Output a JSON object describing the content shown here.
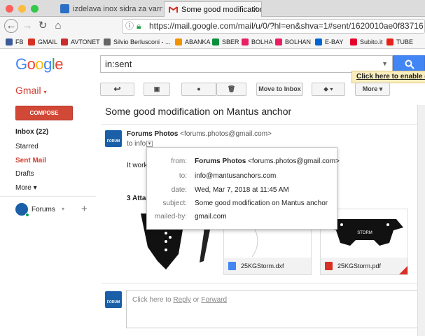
{
  "browser": {
    "tabs": [
      {
        "label": "izdelava inox sidra za varno sid"
      },
      {
        "label": "Some good modification on Ma"
      }
    ],
    "url": "https://mail.google.com/mail/u/0/?hl=en&shva=1#sent/1620010ae0f83716",
    "bookmarks": [
      {
        "label": "FB",
        "color": "#3b5998"
      },
      {
        "label": "GMAIL",
        "color": "#d93025"
      },
      {
        "label": "AVTONET",
        "color": "#cc2b2b"
      },
      {
        "label": "Silvio Berlusconi - ...",
        "color": "#666"
      },
      {
        "label": "ABANKA",
        "color": "#f39200"
      },
      {
        "label": "SBER",
        "color": "#0a8f3c"
      },
      {
        "label": "BOLHA",
        "color": "#e91e63"
      },
      {
        "label": "BOLHAN",
        "color": "#e91e63"
      },
      {
        "label": "E-BAY",
        "color": "#0064d2"
      },
      {
        "label": "Subito.it",
        "color": "#e4002b"
      },
      {
        "label": "TUBE",
        "color": "#e62117"
      }
    ]
  },
  "gmail": {
    "logo": "Google",
    "search_value": "in:sent",
    "enable_notice": "Click here to enable de",
    "section_label": "Gmail",
    "toolbar": {
      "move_to_inbox": "Move to Inbox",
      "more": "More"
    },
    "compose": "COMPOSE",
    "nav": [
      "Inbox (22)",
      "Starred",
      "Sent Mail",
      "Drafts",
      "More"
    ],
    "hangouts_user": "Forums"
  },
  "message": {
    "subject": "Some good modification on Mantus anchor",
    "sender_name": "Forums Photos",
    "sender_email": "<forums.photos@gmail.com>",
    "to_line": "to info",
    "body_start": "It works",
    "attachments_label": "3 Attac",
    "attachments": [
      {
        "name": "25KGStorm.dxf",
        "badge_color": "#4285f4"
      },
      {
        "name": "25KGStorm.pdf",
        "badge_color": "#d93025"
      }
    ],
    "avatar_text": "FORUM"
  },
  "details_popup": {
    "rows": [
      {
        "label": "from:",
        "value_bold": "Forums Photos",
        "value": "<forums.photos@gmail.com>"
      },
      {
        "label": "to:",
        "value": "info@mantusanchors.com"
      },
      {
        "label": "date:",
        "value": "Wed, Mar 7, 2018 at 11:45 AM"
      },
      {
        "label": "subject:",
        "value": "Some good modification on Mantus anchor"
      },
      {
        "label": "mailed-by:",
        "value": "gmail.com"
      }
    ]
  },
  "reply": {
    "prefix": "Click here to ",
    "reply": "Reply",
    "or": " or ",
    "forward": "Forward"
  },
  "colors": {
    "gmail_red": "#d23f31",
    "search_blue": "#4285f4",
    "compose_red": "#d14836"
  }
}
